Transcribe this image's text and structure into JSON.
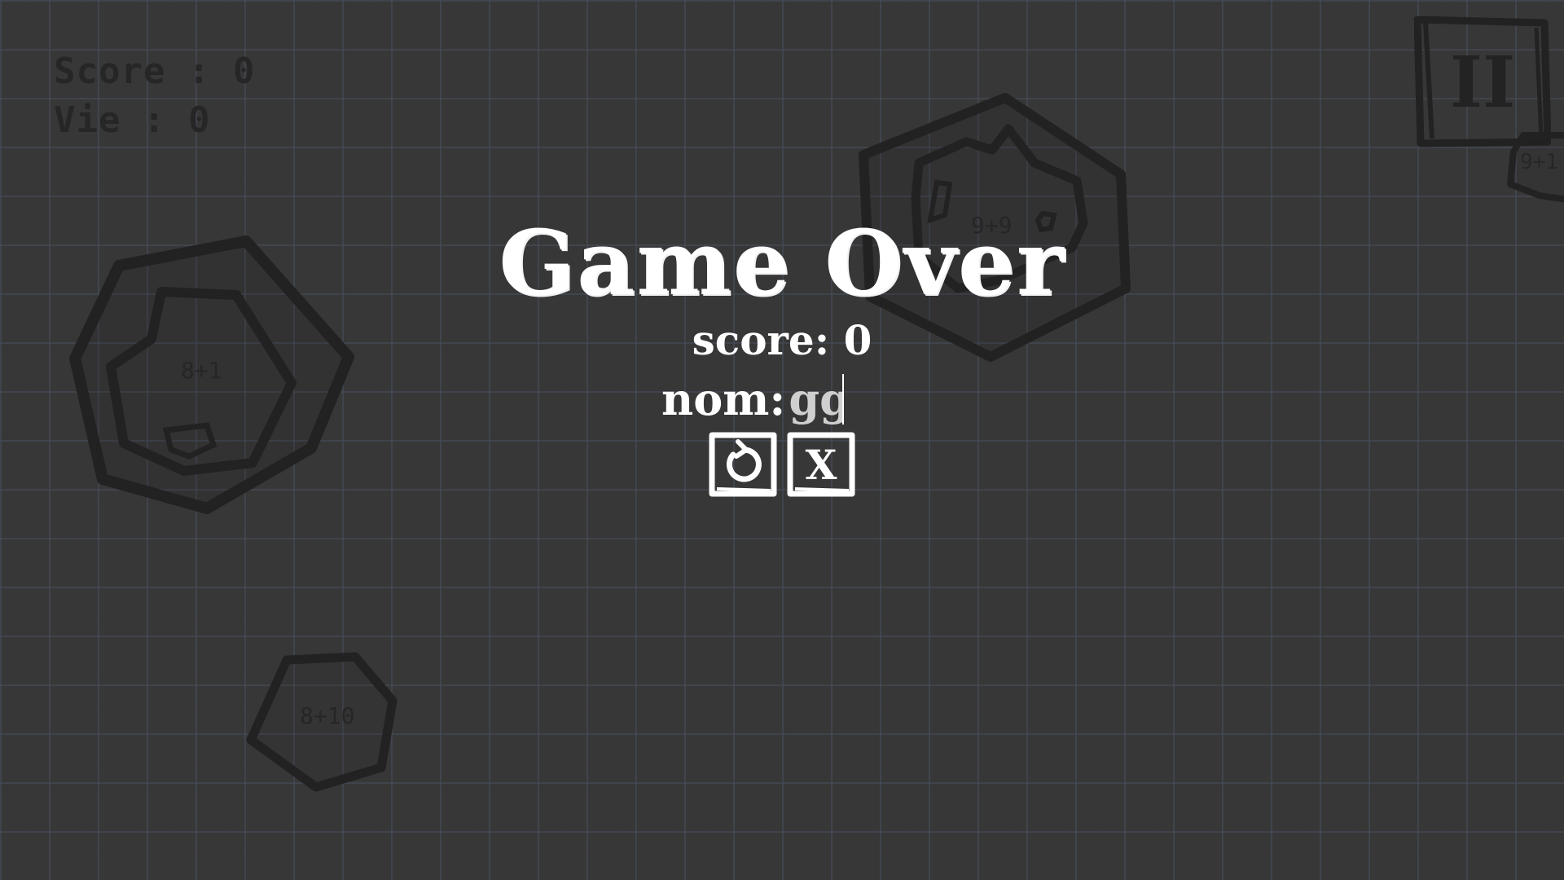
{
  "hud": {
    "score_text": "Score : 0",
    "life_text": "Vie : 0"
  },
  "pause": {
    "label": "II"
  },
  "asteroids": [
    {
      "label": "9+9"
    },
    {
      "label": "8+1"
    },
    {
      "label": "8+10"
    },
    {
      "label": "9+1"
    }
  ],
  "game_over": {
    "title": "Game Over",
    "score_text": "score: 0",
    "name_label": "nom:",
    "name_value": "gg",
    "close_label": "X"
  },
  "icons": {
    "restart": "restart-icon",
    "close": "close-icon",
    "pause": "pause-icon"
  },
  "colors": {
    "background": "#373737",
    "grid": "#464e5c",
    "sketch": "#222222",
    "text_light": "#ffffff"
  }
}
